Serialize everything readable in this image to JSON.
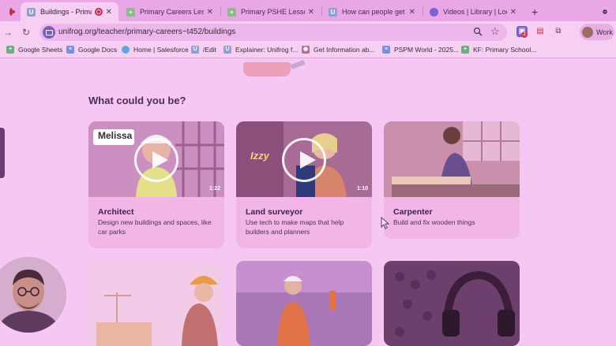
{
  "tabs": [
    {
      "title": "Buildings - Primary",
      "icon": "unifrog-favicon",
      "active": true,
      "recording": true
    },
    {
      "title": "Primary Careers Lesson",
      "icon": "google-slides-favicon"
    },
    {
      "title": "Primary PSHE Lesson Pl",
      "icon": "google-slides-favicon"
    },
    {
      "title": "How can people get fre",
      "icon": "unifrog-favicon"
    },
    {
      "title": "Videos | Library | Loom",
      "icon": "loom-favicon"
    }
  ],
  "new_tab_label": "+",
  "address_bar": {
    "url": "unifrog.org/teacher/primary-careers~t452/buildings"
  },
  "profile": {
    "label": "Work"
  },
  "extension_badge": "2",
  "bookmarks": [
    {
      "label": "Google Sheets",
      "icon": "sheets-icon"
    },
    {
      "label": "Google Docs",
      "icon": "docs-icon"
    },
    {
      "label": "Home | Salesforce",
      "icon": "salesforce-icon"
    },
    {
      "label": "/Edit",
      "icon": "unifrog-icon"
    },
    {
      "label": "Explainer: Unifrog f...",
      "icon": "unifrog-icon"
    },
    {
      "label": "Get Information ab...",
      "icon": "globe-icon"
    },
    {
      "label": "PSPM World - 2025...",
      "icon": "docs-icon"
    },
    {
      "label": "KF: Primary School...",
      "icon": "slides-icon"
    }
  ],
  "section": {
    "title": "What could you be?"
  },
  "cards": [
    {
      "name": "Architect",
      "description": "Design new buildings and spaces, like car parks",
      "duration": "1:22",
      "thumb_label": "Melissa",
      "has_video": true
    },
    {
      "name": "Land surveyor",
      "description": "Use tech to make maps that help builders and planners",
      "duration": "1:10",
      "thumb_label": "Izzy",
      "has_video": true
    },
    {
      "name": "Carpenter",
      "description": "Build and fix wooden things",
      "duration": "",
      "thumb_label": "",
      "has_video": false
    }
  ],
  "colors": {
    "overlay": "#f3c8f0",
    "card": "#f1b5e6",
    "heading": "#4a2d5a",
    "accent": "#7a5bd0"
  }
}
